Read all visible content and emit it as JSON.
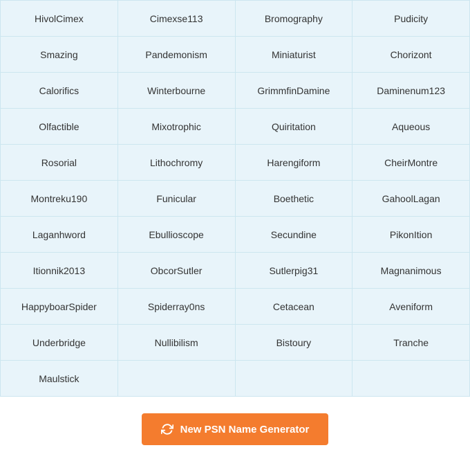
{
  "grid": {
    "cells": [
      "HivolCimex",
      "Cimexse113",
      "Bromography",
      "Pudicity",
      "Smazing",
      "Pandemonism",
      "Miniaturist",
      "Chorizont",
      "Calorifics",
      "Winterbourne",
      "GrimmfinDamine",
      "Daminenum123",
      "Olfactible",
      "Mixotrophic",
      "Quiritation",
      "Aqueous",
      "Rosorial",
      "Lithochromy",
      "Harengiform",
      "CheirMontre",
      "Montreku190",
      "Funicular",
      "Boethetic",
      "GahoolLagan",
      "Laganhword",
      "Ebullioscope",
      "Secundine",
      "PikonItion",
      "Itionnik2013",
      "ObcorSutler",
      "Sutlerpig31",
      "Magnanimous",
      "HappyboarSpider",
      "Spiderray0ns",
      "Cetacean",
      "Aveniform",
      "Underbridge",
      "Nullibilism",
      "Bistoury",
      "Tranche",
      "Maulstick",
      "",
      "",
      ""
    ]
  },
  "button": {
    "label": "New PSN Name Generator"
  }
}
